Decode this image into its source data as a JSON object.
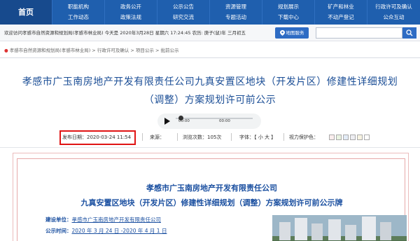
{
  "nav": {
    "home": "首页",
    "columns": [
      {
        "top": "职能机构",
        "bottom": "工作动态"
      },
      {
        "top": "政务公开",
        "bottom": "政策法规"
      },
      {
        "top": "公示公告",
        "bottom": "研究交流"
      },
      {
        "top": "资源管理",
        "bottom": "专题活动"
      },
      {
        "top": "规划展示",
        "bottom": "下载中心"
      },
      {
        "top": "矿产和林业",
        "bottom": "不动产登记"
      },
      {
        "top": "行政许可及确认",
        "bottom": "公众互动"
      }
    ]
  },
  "welcome": {
    "text": "欢迎访问孝感市自然资源和规划局(孝感市林业局)   今天是 2020年3月28日 星期六 17:24:45    农历: 庚子(鼠)年 三月初五",
    "map_button": "地图服务",
    "search_placeholder": ""
  },
  "breadcrumb": "孝感市自然资源和规划局(孝感市林业局)  >  行政许可及确认  >  项目公示  >  批前公示",
  "article": {
    "title_line1": "孝感市广玉南房地产开发有限责任公司九真安置区地块（开发片区）修建性详细规划",
    "title_line2": "（调整）方案规划许可前公示"
  },
  "audio": {
    "current": "00:00",
    "duration": "00:00"
  },
  "meta": {
    "publish_date": "发布日期：2020-03-24 11:54",
    "source": "来源：",
    "views": "浏览次数：105次",
    "font_label": "字体：【 小 大 】",
    "vision_label": "视力保护色：",
    "swatches": [
      "#fbeeee",
      "#e9f3e1",
      "#e3ecf7",
      "#eeeef2",
      "#f7f3e1",
      "#ffffff"
    ]
  },
  "board": {
    "title_line1": "孝感市广玉南房地产开发有限责任公司",
    "title_line2": "九真安置区地块（开发片区）修建性详细规划（调整）方案规划许可前公示牌",
    "row1_label": "建设单位：",
    "row1_value": "孝感市广玉南房地产开发有限责任公司",
    "row2_label": "公示时间：",
    "row2_value": "2020 年 3 月 24 日 -2020 年 4 月 1 日"
  },
  "colors": {
    "nav": "#1f5fae",
    "title": "#1b4e96",
    "highlight": "#e01414"
  }
}
